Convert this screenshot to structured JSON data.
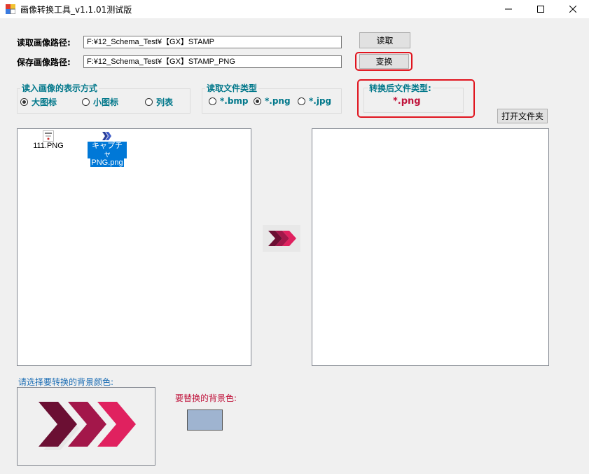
{
  "window": {
    "title": "画像转换工具_v1.1.01测试版",
    "controls": {
      "minimize": "—",
      "maximize": "☐",
      "close": "✕"
    }
  },
  "paths": {
    "read_label": "读取画像路径:",
    "read_value": "F:¥12_Schema_Test¥【GX】STAMP",
    "save_label": "保存画像路径:",
    "save_value": "F:¥12_Schema_Test¥【GX】STAMP_PNG"
  },
  "buttons": {
    "read": "读取",
    "convert": "变换",
    "open_folder": "打开文件夹"
  },
  "display_mode": {
    "title": "读入画像的表示方式",
    "options": [
      "大图标",
      "小图标",
      "列表"
    ],
    "selected": "大图标"
  },
  "file_type": {
    "title": "读取文件类型",
    "options": [
      "*.bmp",
      "*.png",
      "*.jpg"
    ],
    "selected": "*.png"
  },
  "converted_type": {
    "title": "转换后文件类型:",
    "value": "*.png"
  },
  "source_files": [
    {
      "label_line1": "111.PNG",
      "label_line2": "",
      "icon": "stamp-thumbnail-icon",
      "selected": false
    },
    {
      "label_line1": "キャプチャ",
      "label_line2": "PNG.png",
      "icon": "chevron-thumbnail-icon",
      "selected": true
    }
  ],
  "background": {
    "choose_label": "请选择要转换的背景颜色:",
    "replace_label": "要替换的背景色:",
    "swatch_color": "#9fb4d0"
  },
  "colors": {
    "accent_teal": "#00778a",
    "highlight_red": "#e0141e",
    "selection_blue": "#0078d7",
    "arrow_dark": "#6b0f33",
    "arrow_mid": "#a3174a",
    "arrow_light": "#e0215f"
  }
}
